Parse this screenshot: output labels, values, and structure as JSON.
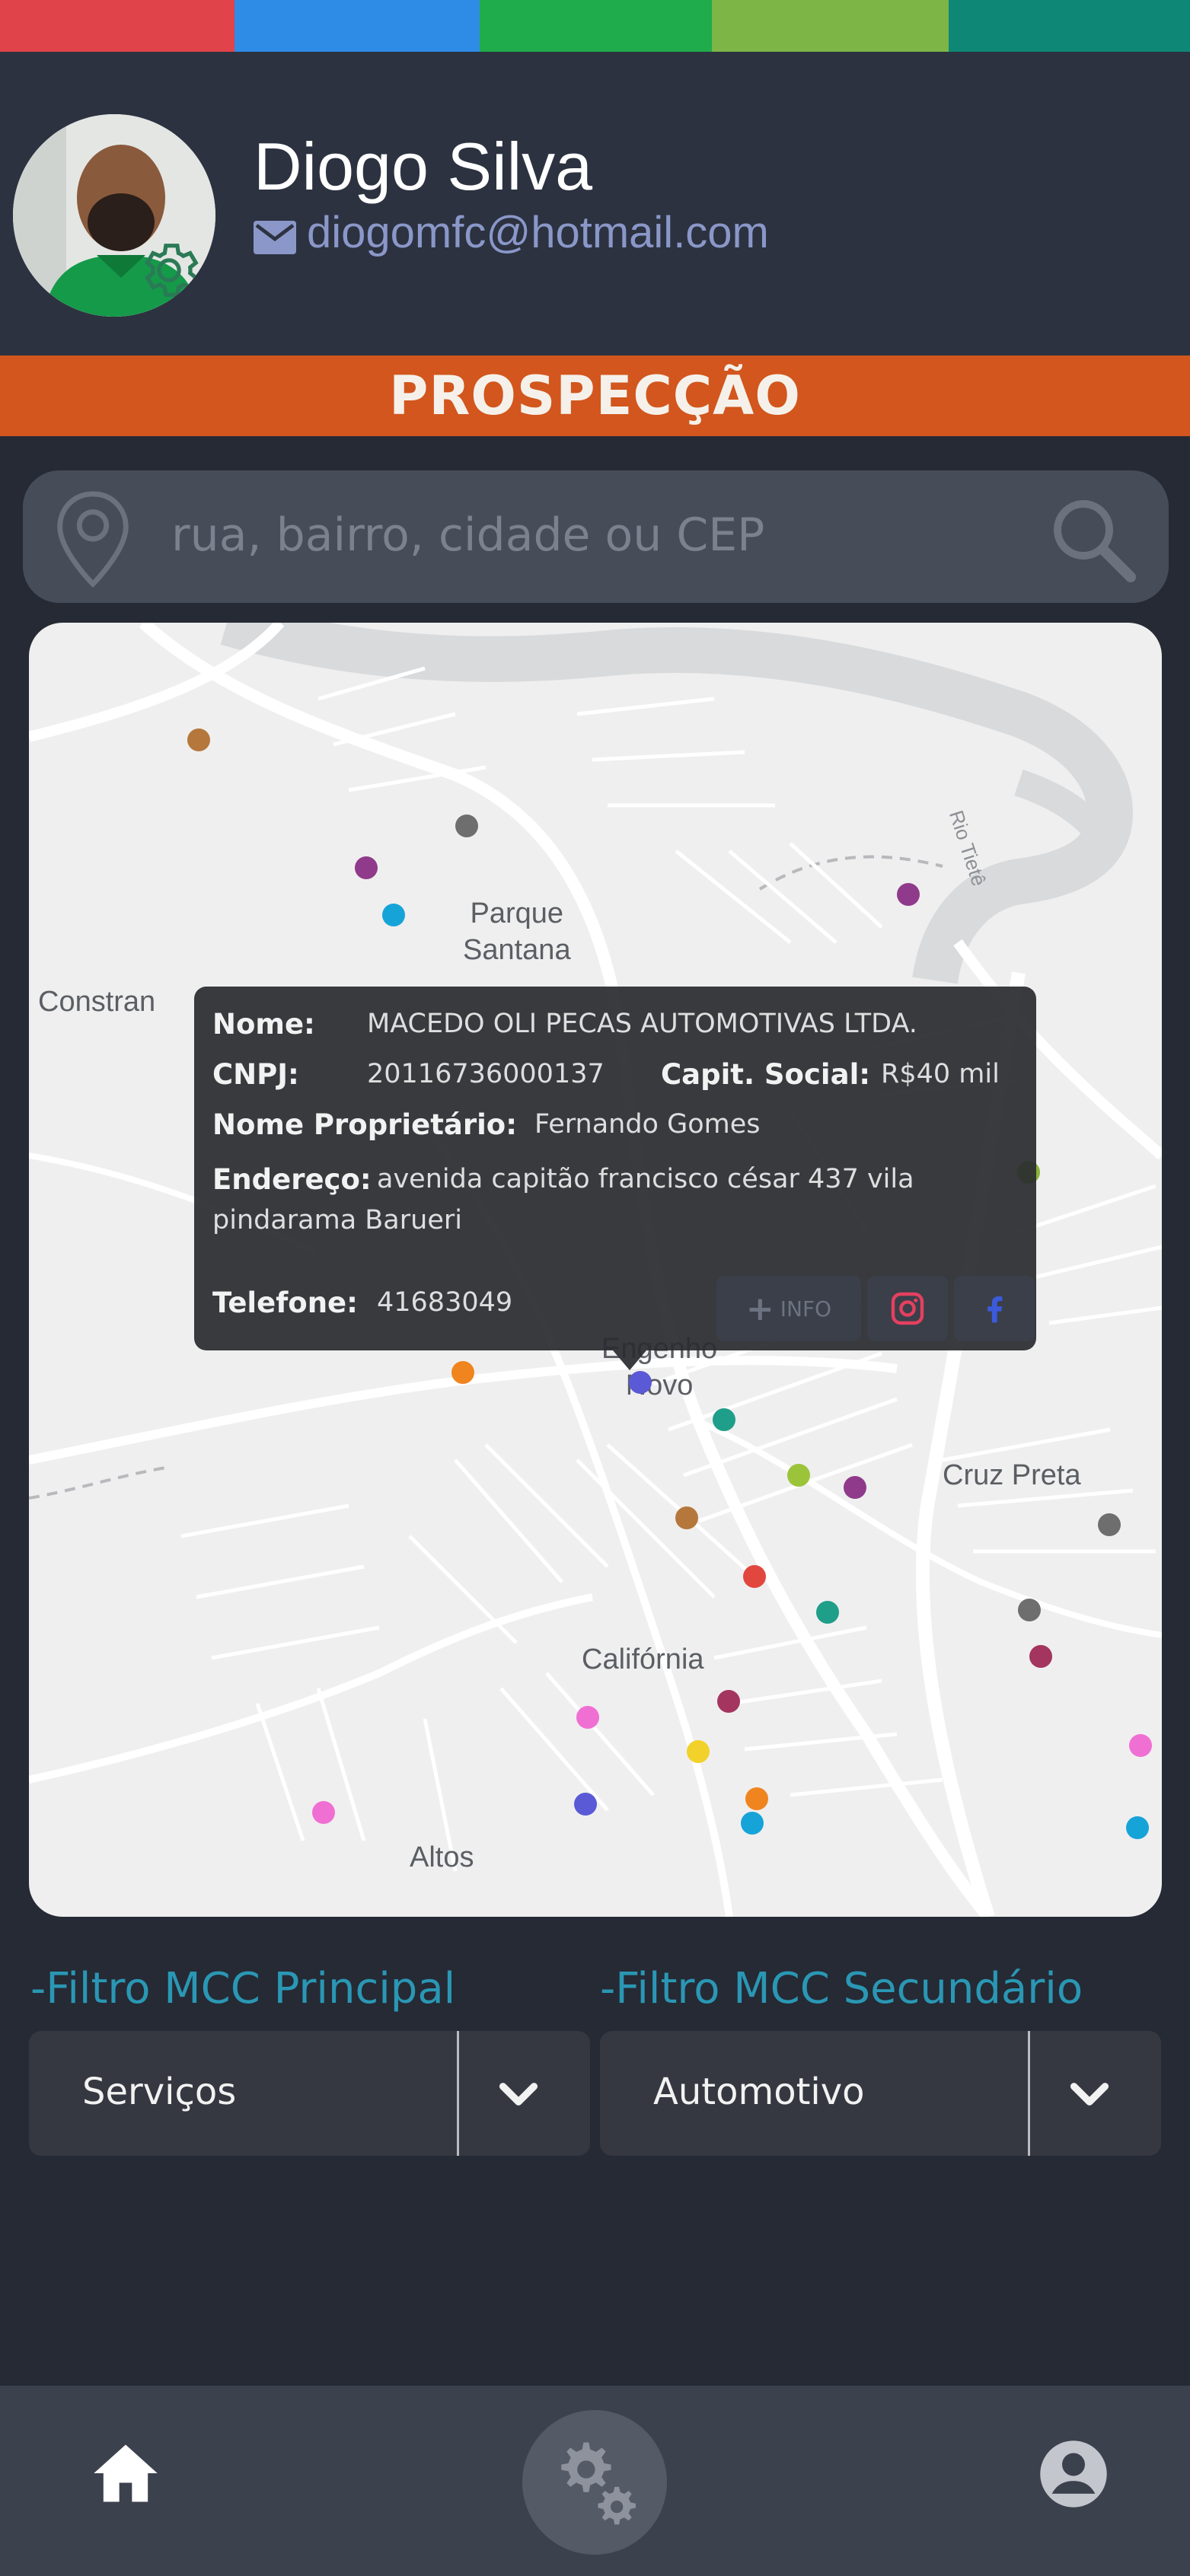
{
  "colors": {
    "topbar": [
      "#e0434a",
      "#2e8be6",
      "#1fac4c",
      "#7db546",
      "#0f8776"
    ],
    "accent_orange": "#d2561d",
    "filter_label": "#2a97b4",
    "email": "#8a97c8",
    "instagram": "#e4405f",
    "facebook": "#3b5bdb"
  },
  "user": {
    "name": "Diogo Silva",
    "email": "diogomfc@hotmail.com",
    "avatar_icon": "gear-icon",
    "email_icon": "envelope-icon"
  },
  "section": {
    "title": "PROSPECÇÃO"
  },
  "search": {
    "placeholder": "rua, bairro, cidade ou CEP",
    "left_icon": "map-pin-icon",
    "right_icon": "search-icon"
  },
  "map": {
    "place_labels": [
      "Parque\nSantana",
      "Constran",
      "Engenho\nNovo",
      "Cruz Preta",
      "Califórnia",
      "Altos",
      "Rio Tietê"
    ],
    "popup": {
      "name_label": "Nome:",
      "name_value": "MACEDO OLI PECAS AUTOMOTIVAS LTDA.",
      "cnpj_label": "CNPJ:",
      "cnpj_value": "20116736000137",
      "capital_label": "Capit. Social:",
      "capital_value": "R$40 mil",
      "owner_label": "Nome Proprietário:",
      "owner_value": "Fernando Gomes",
      "address_label": "Endereço:",
      "address_line1": "avenida capitão francisco césar 437 vila",
      "address_line2": "pindarama Barueri",
      "phone_label": "Telefone:",
      "phone_value": "41683049",
      "info_button": "INFO",
      "info_icon": "plus-icon",
      "instagram_icon": "instagram-icon",
      "facebook_icon": "facebook-icon"
    }
  },
  "filters": {
    "primary": {
      "label": "-Filtro MCC Principal",
      "value": "Serviços"
    },
    "secondary": {
      "label": "-Filtro MCC Secundário",
      "value": "Automotivo"
    }
  },
  "bottom_nav": {
    "home_icon": "home-icon",
    "settings_icon": "gears-icon",
    "profile_icon": "account-icon"
  }
}
